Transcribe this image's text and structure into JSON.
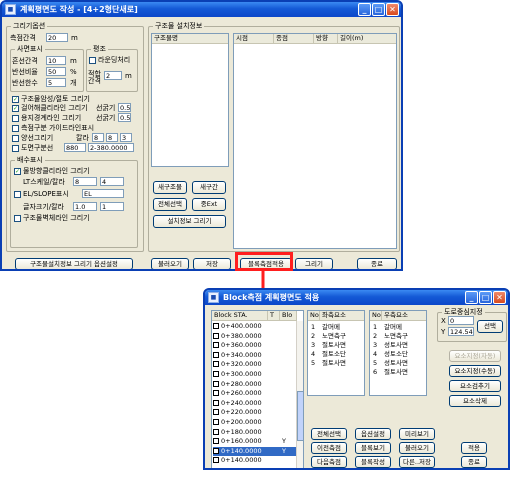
{
  "window1": {
    "title": "계획평면도 작성 - [4+2형단새로]",
    "left_panel": {
      "group_basic": "그리기옵션",
      "survey_interval_label": "측점간격",
      "survey_interval_value": "20",
      "survey_interval_unit": "m",
      "side_group": "사면표시",
      "embank_label": "흔선간격",
      "embank_value": "10",
      "embank_unit": "m",
      "slope_ratio_label": "반선비율",
      "slope_ratio_value": "50",
      "slope_ratio_unit": "%",
      "half_label": "반선한수",
      "half_value": "5",
      "half_unit": "개",
      "berm_group": "평조",
      "berm_check_label": "라운딩처리",
      "berm_interval_label": "적합 간격",
      "berm_interval_value": "2",
      "berm_interval_unit": "m",
      "chk1": "구조물암성/절토 그리기",
      "chk2": "걸어해클리라인 그리기",
      "chk2_line_label": "선굵기",
      "chk2_line_value": "0.5",
      "chk3": "용지경계라인 그리기",
      "chk3_line_label": "선굵기",
      "chk3_line_value": "0.5",
      "chk4": "측점구분 가이드라인표시",
      "chk5": "양선그리기",
      "chk5_color_label": "칼라",
      "chk5_color_values": [
        "8",
        "8",
        "3"
      ],
      "chk6": "도면구분선",
      "chk6_val1": "880",
      "chk6_val2": "2-380.0000",
      "drainage_group": "배수표시",
      "chk7": "물방향클리라인 그리기",
      "lt_label": "LT스케일/칼라",
      "lt_val1": "8",
      "lt_val2": "4",
      "chk8": "EL/SLOPE표시",
      "chk8_value": "EL",
      "text_size_label": "글자크기/칼라",
      "text_size_val1": "1.0",
      "text_size_val2": "1",
      "chk9": "구조물벽체라인 그리기"
    },
    "struct_panel": {
      "title": "구조물 설치정보",
      "list_header": "구조물명",
      "detail_headers": [
        "시점",
        "종점",
        "방향",
        "길이(m)"
      ],
      "btn_new": "새구조물",
      "btn_new_gap": "새구간",
      "btn_select_all": "전체선택",
      "btn_edit": "중Ext",
      "btn_draw_info": "설치정보 그리기"
    },
    "bottom_buttons": [
      "구조물설치정보 그리기 옵션설정",
      "불러오기",
      "저장",
      "블록측점적용",
      "그리기",
      "종료"
    ]
  },
  "window2": {
    "title": "Block측점 계획평면도 적용",
    "block_headers": [
      "Block STA.",
      "T",
      "Blo"
    ],
    "block_rows": [
      {
        "sta": "0+400.0000",
        "t": "",
        "b": ""
      },
      {
        "sta": "0+380.0000",
        "t": "",
        "b": ""
      },
      {
        "sta": "0+360.0000",
        "t": "",
        "b": ""
      },
      {
        "sta": "0+340.0000",
        "t": "",
        "b": ""
      },
      {
        "sta": "0+320.0000",
        "t": "",
        "b": ""
      },
      {
        "sta": "0+300.0000",
        "t": "",
        "b": ""
      },
      {
        "sta": "0+280.0000",
        "t": "",
        "b": ""
      },
      {
        "sta": "0+260.0000",
        "t": "",
        "b": ""
      },
      {
        "sta": "0+240.0000",
        "t": "",
        "b": ""
      },
      {
        "sta": "0+220.0000",
        "t": "",
        "b": ""
      },
      {
        "sta": "0+200.0000",
        "t": "",
        "b": ""
      },
      {
        "sta": "0+180.0000",
        "t": "",
        "b": ""
      },
      {
        "sta": "0+160.0000",
        "t": "",
        "b": "Y"
      },
      {
        "sta": "0+140.0000",
        "t": "",
        "b": "Y"
      },
      {
        "sta": "0+140.0000",
        "t": "",
        "b": ""
      }
    ],
    "left_headers": [
      "No",
      "좌측요소"
    ],
    "left_items": [
      {
        "no": "1",
        "name": "갈머메"
      },
      {
        "no": "2",
        "name": "노면측구"
      },
      {
        "no": "3",
        "name": "절토사면"
      },
      {
        "no": "4",
        "name": "절토소단"
      },
      {
        "no": "5",
        "name": "절토사면"
      }
    ],
    "right_headers": [
      "No",
      "우측요소"
    ],
    "right_items": [
      {
        "no": "1",
        "name": "갈머메"
      },
      {
        "no": "2",
        "name": "노면측구"
      },
      {
        "no": "3",
        "name": "성토사면"
      },
      {
        "no": "4",
        "name": "성토소단"
      },
      {
        "no": "5",
        "name": "성토사면"
      },
      {
        "no": "6",
        "name": "절토사면"
      }
    ],
    "road_center_group": "도로중심지정",
    "x_label": "X",
    "x_value": "0",
    "y_label": "Y",
    "y_value": "124.5411",
    "btn_select": "선택",
    "btn_elem_specify_disabled": "요소지정(자동)",
    "btn_elem_specify_manual": "요소지정(수동)",
    "btn_elem_add": "요소검추기",
    "btn_elem_delete": "요소삭제",
    "action_buttons_row1": [
      "전체선택",
      "옵션설정",
      "미리보기"
    ],
    "action_buttons_row2": [
      "이전측점",
      "블록보기",
      "불러오기"
    ],
    "action_buttons_row3": [
      "다음측점",
      "블록작성",
      "다른..저장"
    ],
    "btn_apply": "적용",
    "btn_close": "종료"
  },
  "colors": {
    "highlight": "#ff1e1e",
    "arrow": "#ff1e1e",
    "titlebar": "#0c47c9"
  }
}
